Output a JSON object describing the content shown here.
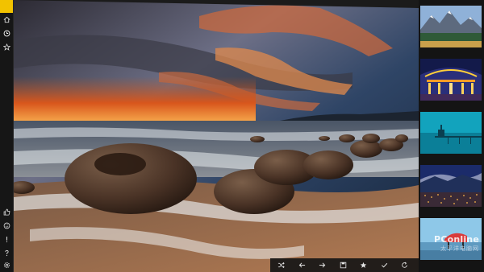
{
  "rail": {
    "top_items": [
      {
        "icon": "home-icon",
        "glyph": "⌂"
      },
      {
        "icon": "clock-icon",
        "glyph": "◷"
      },
      {
        "icon": "star-icon",
        "glyph": "☆"
      }
    ],
    "bottom_items": [
      {
        "icon": "thumbs-up-icon",
        "glyph": "👍"
      },
      {
        "icon": "smiley-icon",
        "glyph": "☺"
      },
      {
        "icon": "exclamation-icon",
        "glyph": "!"
      },
      {
        "icon": "help-icon",
        "glyph": "?"
      },
      {
        "icon": "gear-icon",
        "glyph": "⚙"
      }
    ]
  },
  "commands": [
    {
      "icon": "shuffle-icon",
      "glyph": "⤮"
    },
    {
      "icon": "arrow-left-icon",
      "glyph": "←"
    },
    {
      "icon": "arrow-right-icon",
      "glyph": "→"
    },
    {
      "icon": "save-icon",
      "glyph": "▣"
    },
    {
      "icon": "star-icon",
      "glyph": "★"
    },
    {
      "icon": "check-icon",
      "glyph": "✓"
    },
    {
      "icon": "refresh-icon",
      "glyph": "↻"
    },
    {
      "icon": "more-icon",
      "glyph": "…"
    }
  ],
  "filmstrip": {
    "thumbnails": [
      {
        "name": "mountain-lake"
      },
      {
        "name": "neon-building"
      },
      {
        "name": "pier-blue"
      },
      {
        "name": "night-city"
      },
      {
        "name": "festival-stage"
      }
    ]
  },
  "watermark": {
    "brand": "PConline",
    "sub": "太平洋电脑网"
  },
  "colors": {
    "accent": "#f2c200",
    "rail_bg": "#161616",
    "bar_bg": "#161616"
  }
}
